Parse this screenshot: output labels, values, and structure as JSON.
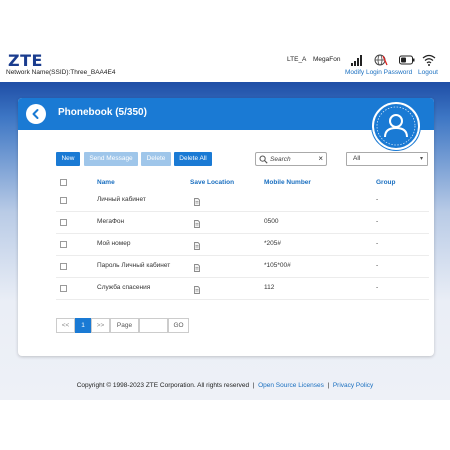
{
  "header": {
    "logo": "ZTE",
    "ssid": "Network Name(SSID):Three_BAA4E4",
    "network_type": "LTE_A",
    "operator": "MegaFon",
    "modify_password": "Modify Login Password",
    "logout": "Logout"
  },
  "phonebook": {
    "title": "Phonebook (5/350)",
    "buttons": {
      "new": "New",
      "send": "Send Message",
      "delete": "Delete",
      "delete_all": "Delete All"
    },
    "search_placeholder": "Search",
    "filter": "All",
    "columns": {
      "name": "Name",
      "location": "Save Location",
      "mobile": "Mobile Number",
      "group": "Group"
    },
    "rows": [
      {
        "name": "Личный кабинет",
        "mobile": "",
        "group": "-"
      },
      {
        "name": "МегаФон",
        "mobile": "0500",
        "group": "-"
      },
      {
        "name": "Мой номер",
        "mobile": "*205#",
        "group": "-"
      },
      {
        "name": "Пароль Личный кабинет",
        "mobile": "*105*00#",
        "group": "-"
      },
      {
        "name": "Служба спасения",
        "mobile": "112",
        "group": "-"
      }
    ],
    "pager": {
      "prev": "<<",
      "current": "1",
      "next": ">>",
      "page_label": "Page",
      "go": "GO"
    }
  },
  "footer": {
    "copyright": "Copyright © 1998-2023 ZTE Corporation. All rights reserved",
    "sep": "|",
    "open_source": "Open Source Licenses",
    "privacy": "Privacy Policy"
  },
  "colors": {
    "brand": "#1a3c8e",
    "accent": "#1a7ad4",
    "link": "#1a6fc0"
  }
}
